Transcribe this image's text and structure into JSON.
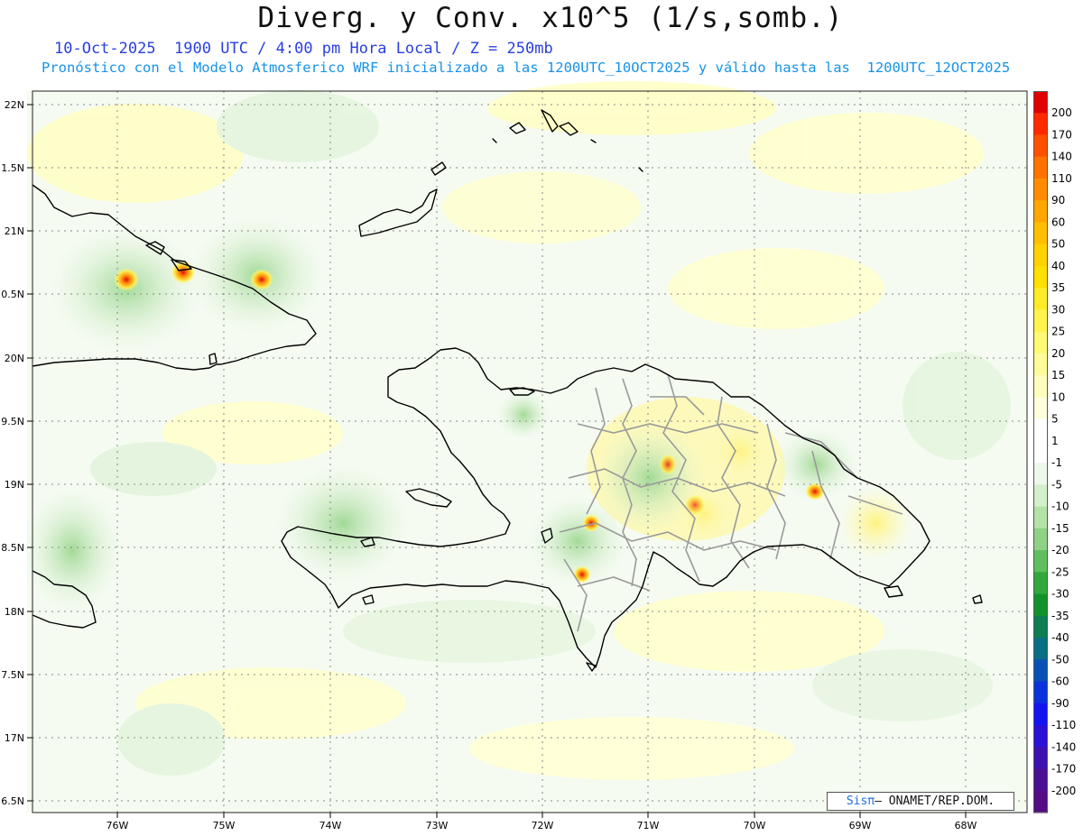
{
  "header": {
    "title": "Diverg. y Conv. x10^5 (1/s,somb.)",
    "subtitle_line1": "10-Oct-2025  1900 UTC / 4:00 pm Hora Local / Z = 250mb",
    "subtitle_line2": "Pronóstico con el Modelo Atmosferico WRF inicializado a las 1200UTC_10OCT2025 y válido hasta las  1200UTC_12OCT2025"
  },
  "map": {
    "lat_labels": [
      "22N",
      "1.5N",
      "21N",
      "0.5N",
      "20N",
      "9.5N",
      "19N",
      "8.5N",
      "18N",
      "7.5N",
      "17N",
      "6.5N"
    ],
    "lon_labels": [
      "76W",
      "75W",
      "74W",
      "73W",
      "72W",
      "71W",
      "70W",
      "69W",
      "68W"
    ],
    "colors": {
      "coastline": "#000000",
      "province_borders": "#9a9a9a",
      "grid_lines": "#888888",
      "divergence_light": "#ffffa8",
      "convergence_light": "#dff2da"
    }
  },
  "credit": {
    "logo": "Sisπ",
    "text": "– ONAMET/REP.DOM."
  },
  "colorbar": {
    "labels": [
      "200",
      "170",
      "140",
      "110",
      "90",
      "60",
      "50",
      "40",
      "35",
      "30",
      "25",
      "20",
      "15",
      "10",
      "5",
      "1",
      "-1",
      "-5",
      "-10",
      "-15",
      "-20",
      "-25",
      "-30",
      "-35",
      "-40",
      "-50",
      "-60",
      "-90",
      "-110",
      "-140",
      "-170",
      "-200"
    ],
    "colors": [
      "#e00000",
      "#ff2a00",
      "#ff4f00",
      "#ff7200",
      "#ff8c00",
      "#ffa600",
      "#ffbe00",
      "#ffd200",
      "#ffe000",
      "#ffec28",
      "#fff34e",
      "#fff874",
      "#fffb98",
      "#fffdbc",
      "#fffedd",
      "#ffffff",
      "#ffffff",
      "#eef8ea",
      "#d4efcb",
      "#b4e3a8",
      "#8ed286",
      "#5fbf5c",
      "#33a83a",
      "#13922a",
      "#0e7d52",
      "#0a6e84",
      "#0a4fb4",
      "#0a32dc",
      "#1414f0",
      "#2b10d8",
      "#3d10b0",
      "#4a0f92",
      "#560a86"
    ]
  }
}
